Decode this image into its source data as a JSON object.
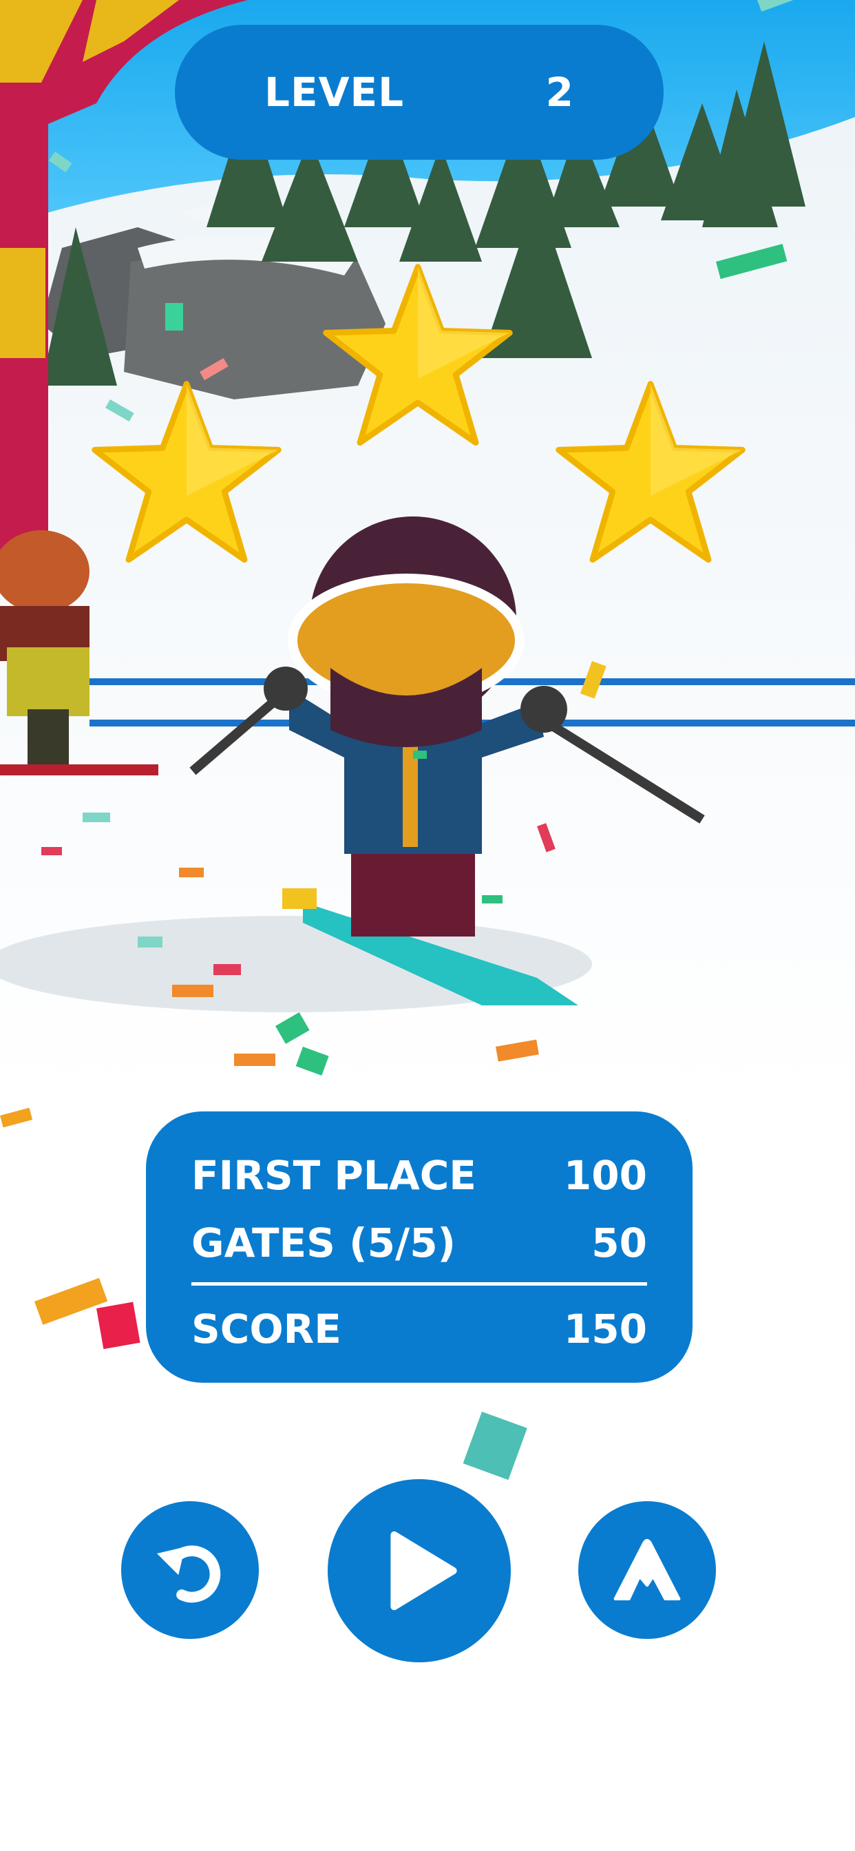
{
  "header": {
    "level_label": "LEVEL",
    "level_number": "2"
  },
  "stars": {
    "earned": 3,
    "total": 3
  },
  "score_panel": {
    "rows": [
      {
        "label": "FIRST PLACE",
        "value": "100"
      },
      {
        "label": "GATES (5/5)",
        "value": "50"
      }
    ],
    "total_label": "SCORE",
    "total_value": "150"
  },
  "buttons": {
    "restart_icon": "restart-icon",
    "play_icon": "play-icon",
    "skin_icon": "mountain-icon"
  },
  "colors": {
    "accent": "#0a7ccf",
    "star": "#ffd21a",
    "sky": "#27b6f0",
    "snow": "#ffffff"
  }
}
